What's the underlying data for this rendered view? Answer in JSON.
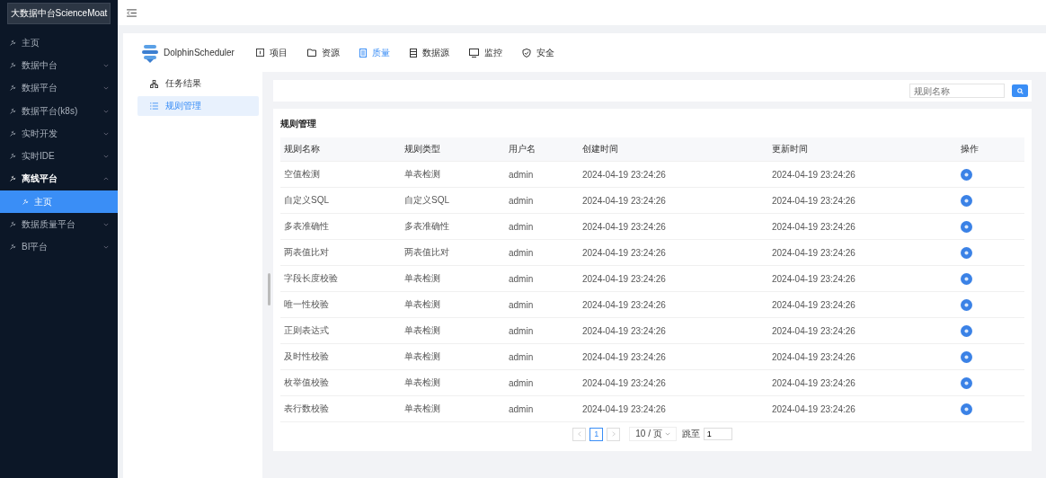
{
  "sidebar": {
    "title": "大数据中台ScienceMoat",
    "items": [
      {
        "label": "主页"
      },
      {
        "label": "数据中台",
        "expanded": false
      },
      {
        "label": "数据平台",
        "expanded": false
      },
      {
        "label": "数据平台(k8s)",
        "expanded": false
      },
      {
        "label": "实时开发",
        "expanded": false
      },
      {
        "label": "实时IDE",
        "expanded": false
      },
      {
        "label": "离线平台",
        "expanded": true,
        "children": [
          {
            "label": "主页",
            "selected": true
          }
        ]
      },
      {
        "label": "数据质量平台",
        "expanded": false
      },
      {
        "label": "BI平台",
        "expanded": false
      }
    ]
  },
  "app": {
    "logo": "DolphinScheduler",
    "tabs": [
      {
        "label": "项目",
        "selected": false
      },
      {
        "label": "资源",
        "selected": false
      },
      {
        "label": "质量",
        "selected": true
      },
      {
        "label": "数据源",
        "selected": false
      },
      {
        "label": "监控",
        "selected": false
      },
      {
        "label": "安全",
        "selected": false
      }
    ],
    "submenu": [
      {
        "label": "任务结果",
        "selected": false
      },
      {
        "label": "规则管理",
        "selected": true
      }
    ]
  },
  "search": {
    "placeholder": "规则名称"
  },
  "panel": {
    "title": "规则管理",
    "columns": [
      "规则名称",
      "规则类型",
      "用户名",
      "创建时间",
      "更新时间",
      "操作"
    ],
    "rows": [
      [
        "空值检测",
        "单表检测",
        "admin",
        "2024-04-19 23:24:26",
        "2024-04-19 23:24:26"
      ],
      [
        "自定义SQL",
        "自定义SQL",
        "admin",
        "2024-04-19 23:24:26",
        "2024-04-19 23:24:26"
      ],
      [
        "多表准确性",
        "多表准确性",
        "admin",
        "2024-04-19 23:24:26",
        "2024-04-19 23:24:26"
      ],
      [
        "两表值比对",
        "两表值比对",
        "admin",
        "2024-04-19 23:24:26",
        "2024-04-19 23:24:26"
      ],
      [
        "字段长度校验",
        "单表检测",
        "admin",
        "2024-04-19 23:24:26",
        "2024-04-19 23:24:26"
      ],
      [
        "唯一性校验",
        "单表检测",
        "admin",
        "2024-04-19 23:24:26",
        "2024-04-19 23:24:26"
      ],
      [
        "正则表达式",
        "单表检测",
        "admin",
        "2024-04-19 23:24:26",
        "2024-04-19 23:24:26"
      ],
      [
        "及时性校验",
        "单表检测",
        "admin",
        "2024-04-19 23:24:26",
        "2024-04-19 23:24:26"
      ],
      [
        "枚举值校验",
        "单表检测",
        "admin",
        "2024-04-19 23:24:26",
        "2024-04-19 23:24:26"
      ],
      [
        "表行数校验",
        "单表检测",
        "admin",
        "2024-04-19 23:24:26",
        "2024-04-19 23:24:26"
      ]
    ]
  },
  "pagination": {
    "pages": [
      {
        "label": "1",
        "selected": true
      }
    ],
    "page_size": "10 / 页",
    "jump_label": "跳至",
    "jump_value": "1"
  }
}
